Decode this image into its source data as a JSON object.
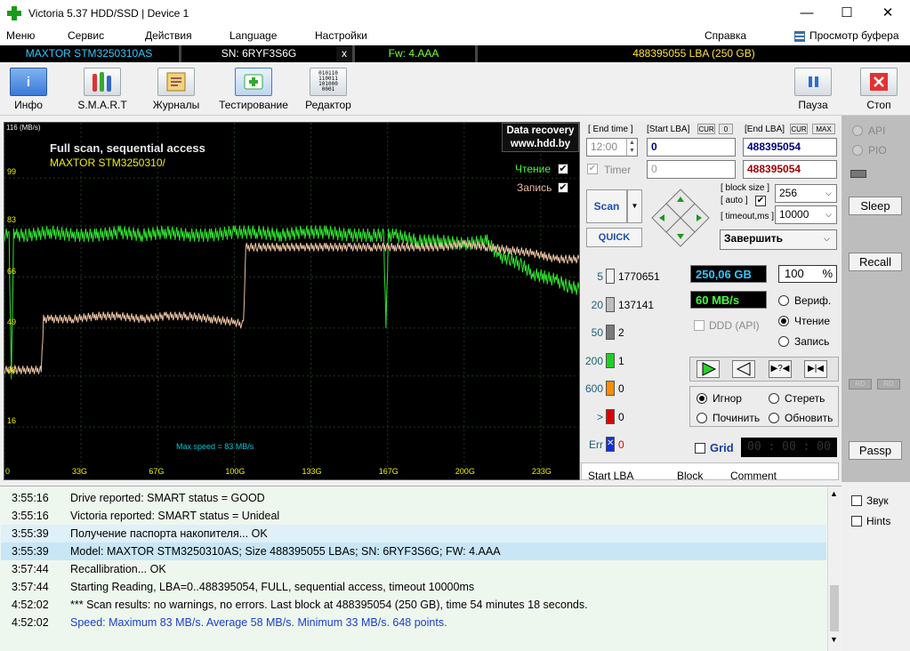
{
  "window": {
    "title": "Victoria 5.37 HDD/SSD | Device 1",
    "minimize_glyph": "—",
    "maximize_glyph": "☐",
    "close_glyph": "✕"
  },
  "menu": {
    "items": [
      "Меню",
      "Сервис",
      "Действия",
      "Language",
      "Настройки",
      "Справка"
    ],
    "buffer_view": "Просмотр буфера"
  },
  "device_bar": {
    "model": "MAXTOR STM3250310AS",
    "serial": "SN: 6RYF3S6G",
    "x": "x",
    "firmware": "Fw: 4.AAA",
    "lba": "488395055 LBA (250 GB)"
  },
  "toolbar": {
    "info": "Инфо",
    "smart": "S.M.A.R.T",
    "logs": "Журналы",
    "testing": "Тестирование",
    "editor": "Редактор",
    "editor_icon_text": "010110\n110011\n101000\n0001",
    "pause": "Пауза",
    "stop": "Стоп"
  },
  "graph": {
    "title": "Full scan, sequential access",
    "model": "MAXTOR STM3250310/",
    "recovery_line1": "Data recovery",
    "recovery_line2": "www.hdd.by",
    "legend_read": "Чтение",
    "legend_write": "Запись",
    "max_speed": "Max speed = 83 MB/s",
    "y_unit_top": "116 (MB/s)",
    "y_ticks": [
      "99",
      "83",
      "66",
      "49",
      "33",
      "16"
    ],
    "x_ticks": [
      "0",
      "33G",
      "67G",
      "100G",
      "133G",
      "167G",
      "200G",
      "233G"
    ],
    "colors": {
      "read": "#2fe02f",
      "write": "#e8c0a0",
      "grid": "#1f3a1f",
      "text_yellow": "#f0f000",
      "text_cyan": "#00c8d8"
    }
  },
  "chart_data": {
    "type": "line",
    "title": "Full scan, sequential access",
    "xlabel": "",
    "ylabel": "(MB/s)",
    "ylim": [
      0,
      116
    ],
    "xlim": [
      0,
      250
    ],
    "x_tick_labels": [
      "0",
      "33G",
      "67G",
      "100G",
      "133G",
      "167G",
      "200G",
      "233G"
    ],
    "series": [
      {
        "name": "Чтение",
        "x": [
          0,
          2,
          3,
          4,
          5,
          10,
          20,
          30,
          40,
          50,
          60,
          70,
          80,
          90,
          100,
          110,
          120,
          130,
          140,
          150,
          160,
          165,
          166,
          167,
          170,
          180,
          190,
          200,
          210,
          215,
          220,
          225,
          230,
          235,
          240,
          245,
          250
        ],
        "y": [
          80,
          80,
          33,
          80,
          80,
          80,
          81,
          80,
          80,
          81,
          80,
          81,
          80,
          80,
          81,
          81,
          80,
          81,
          81,
          80,
          80,
          80,
          50,
          80,
          80,
          78,
          78,
          77,
          78,
          73,
          72,
          70,
          67,
          66,
          65,
          63,
          62
        ]
      },
      {
        "name": "Запись",
        "x": [
          0,
          5,
          16,
          17,
          20,
          30,
          40,
          50,
          60,
          70,
          80,
          90,
          100,
          104,
          105,
          110,
          120,
          130,
          140,
          150,
          160,
          170,
          180,
          190,
          200,
          210,
          220,
          230,
          235,
          240,
          245,
          250
        ],
        "y": [
          35,
          35,
          35,
          52,
          52,
          52,
          53,
          53,
          52,
          53,
          53,
          52,
          51,
          50,
          76,
          76,
          76,
          76,
          76,
          76,
          76,
          76,
          76,
          76,
          77,
          76,
          75,
          74,
          73,
          72,
          72,
          72
        ]
      }
    ],
    "annotations": [
      "Max speed = 83 MB/s"
    ]
  },
  "controls": {
    "end_time_label": "[ End time ]",
    "end_time_value": "12:00",
    "start_lba_label": "[Start LBA]",
    "cur": "CUR",
    "zero": "0",
    "start_lba_value": "0",
    "end_lba_label": "[End LBA]",
    "max": "MAX",
    "end_lba_value": "488395054",
    "timer_label": "Timer",
    "timer_value": "0",
    "current_lba_value": "488395054",
    "scan": "Scan",
    "quick": "QUICK",
    "block_size_label": "[ block size ]",
    "auto_label": "[ auto ]",
    "block_size_value": "256",
    "timeout_label": "[ timeout,ms ]",
    "timeout_value": "10000",
    "finish_value": "Завершить"
  },
  "blocks": [
    {
      "label": "5",
      "count": "1770651",
      "color": "#f2f2f2"
    },
    {
      "label": "20",
      "count": "137141",
      "color": "#bdbdbd"
    },
    {
      "label": "50",
      "count": "2",
      "color": "#7a7a7a"
    },
    {
      "label": "200",
      "count": "1",
      "color": "#20d020"
    },
    {
      "label": "600",
      "count": "0",
      "color": "#ff8c00"
    },
    {
      "label": ">",
      "count": "0",
      "color": "#e00000"
    },
    {
      "label": "Err",
      "count": "0",
      "color": "#1030e0"
    }
  ],
  "stats": {
    "size": "250,06 GB",
    "percent": "100",
    "percent_sign": "%",
    "speed": "60 MB/s",
    "ddd": "DDD (API)",
    "mode_verify": "Вериф.",
    "mode_read": "Чтение",
    "mode_write": "Запись",
    "ignore": "Игнор",
    "erase": "Стереть",
    "repair": "Починить",
    "refresh": "Обновить",
    "grid": "Grid",
    "grid_time": "00 : 00 : 00",
    "table_col1": "Start LBA",
    "table_col2": "Block",
    "table_col3": "Comment"
  },
  "sidebar": {
    "api": "API",
    "pio": "PIO",
    "sleep": "Sleep",
    "recall": "Recall",
    "rd1": "RD",
    "rd2": "RD",
    "passp": "Passp"
  },
  "log": [
    {
      "time": "3:55:16",
      "msg": "Drive reported: SMART status = GOOD",
      "style": "normal"
    },
    {
      "time": "3:55:16",
      "msg": "Victoria reported: SMART status = Unideal",
      "style": "normal"
    },
    {
      "time": "3:55:39",
      "msg": "Получение паспорта накопителя... OK",
      "style": "alt"
    },
    {
      "time": "3:55:39",
      "msg": "Model: MAXTOR STM3250310AS; Size 488395055 LBAs; SN: 6RYF3S6G; FW: 4.AAA",
      "style": "selected"
    },
    {
      "time": "3:57:44",
      "msg": "Recallibration... OK",
      "style": "normal"
    },
    {
      "time": "3:57:44",
      "msg": "Starting Reading, LBA=0..488395054, FULL, sequential access, timeout 10000ms",
      "style": "normal"
    },
    {
      "time": "4:52:02",
      "msg": "*** Scan results: no warnings, no errors. Last block at 488395054 (250 GB), time 54 minutes 18 seconds.",
      "style": "normal"
    },
    {
      "time": "4:52:02",
      "msg": "Speed: Maximum 83 MB/s. Average 58 MB/s. Minimum 33 MB/s. 648 points.",
      "style": "blue"
    }
  ],
  "log_options": {
    "sound": "Звук",
    "hints": "Hints"
  }
}
